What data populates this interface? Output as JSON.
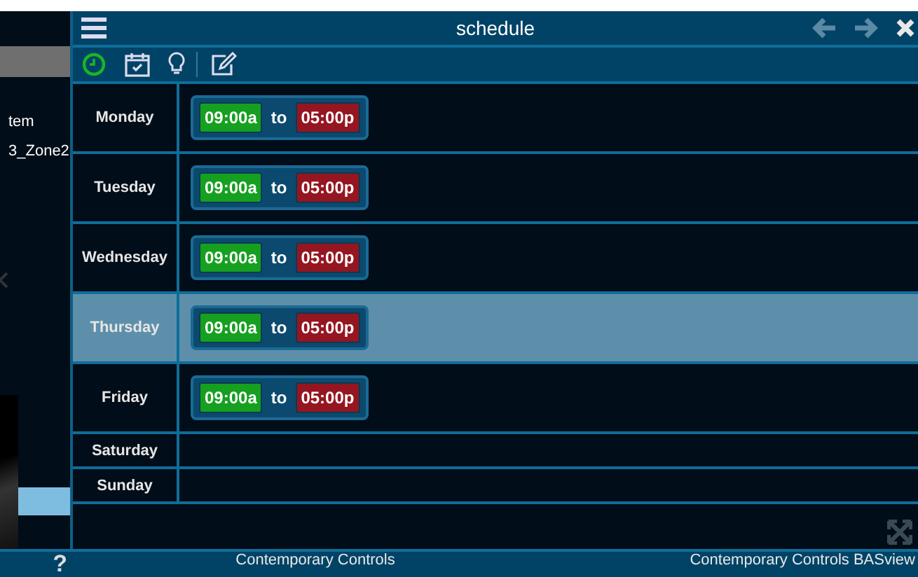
{
  "background": {
    "items": [
      "tem",
      "3_Zone2"
    ]
  },
  "window": {
    "title": "schedule"
  },
  "toolbar": [
    {
      "kind": "clock",
      "selected": true
    },
    {
      "kind": "calendar",
      "selected": false
    },
    {
      "kind": "bulb",
      "selected": false
    },
    {
      "kind": "edit",
      "selected": false
    }
  ],
  "days": [
    {
      "name": "Monday",
      "selected": false,
      "ranges": [
        {
          "start": "09:00a",
          "sep": "to",
          "end": "05:00p"
        }
      ]
    },
    {
      "name": "Tuesday",
      "selected": false,
      "ranges": [
        {
          "start": "09:00a",
          "sep": "to",
          "end": "05:00p"
        }
      ]
    },
    {
      "name": "Wednesday",
      "selected": false,
      "ranges": [
        {
          "start": "09:00a",
          "sep": "to",
          "end": "05:00p"
        }
      ]
    },
    {
      "name": "Thursday",
      "selected": true,
      "ranges": [
        {
          "start": "09:00a",
          "sep": "to",
          "end": "05:00p"
        }
      ]
    },
    {
      "name": "Friday",
      "selected": false,
      "ranges": [
        {
          "start": "09:00a",
          "sep": "to",
          "end": "05:00p"
        }
      ]
    },
    {
      "name": "Saturday",
      "selected": false
    },
    {
      "name": "Sunday",
      "selected": false
    }
  ],
  "status_bar": {
    "help": "?",
    "center": "Contemporary Controls",
    "right": "Contemporary Controls BASview"
  }
}
